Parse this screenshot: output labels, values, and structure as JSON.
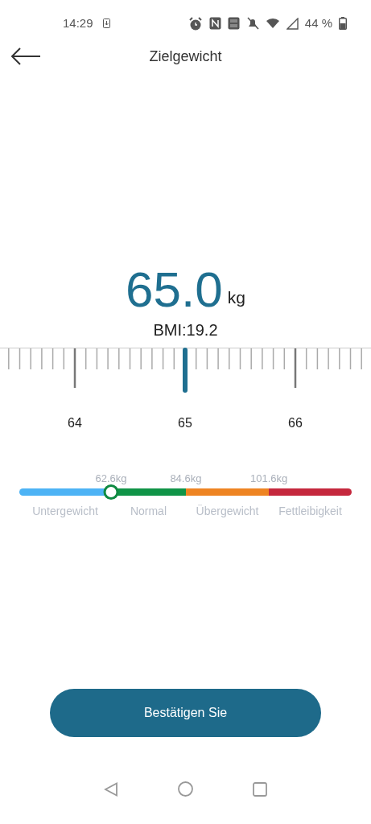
{
  "status_bar": {
    "time": "14:29",
    "battery": "44 %"
  },
  "header": {
    "title": "Zielgewicht"
  },
  "weight": {
    "value": "65.0",
    "unit": "kg"
  },
  "bmi": "BMI:19.2",
  "ruler": {
    "labels": [
      "64",
      "65",
      "66"
    ]
  },
  "bmi_scale": {
    "thresholds": [
      "62.6kg",
      "84.6kg",
      "101.6kg"
    ],
    "segments": [
      {
        "label": "Untergewicht",
        "color": "#4db3f5"
      },
      {
        "label": "Normal",
        "color": "#0f9447"
      },
      {
        "label": "Übergewicht",
        "color": "#ee8422"
      },
      {
        "label": "Fettleibigkeit",
        "color": "#c5283d"
      }
    ]
  },
  "confirm_button": "Bestätigen Sie"
}
